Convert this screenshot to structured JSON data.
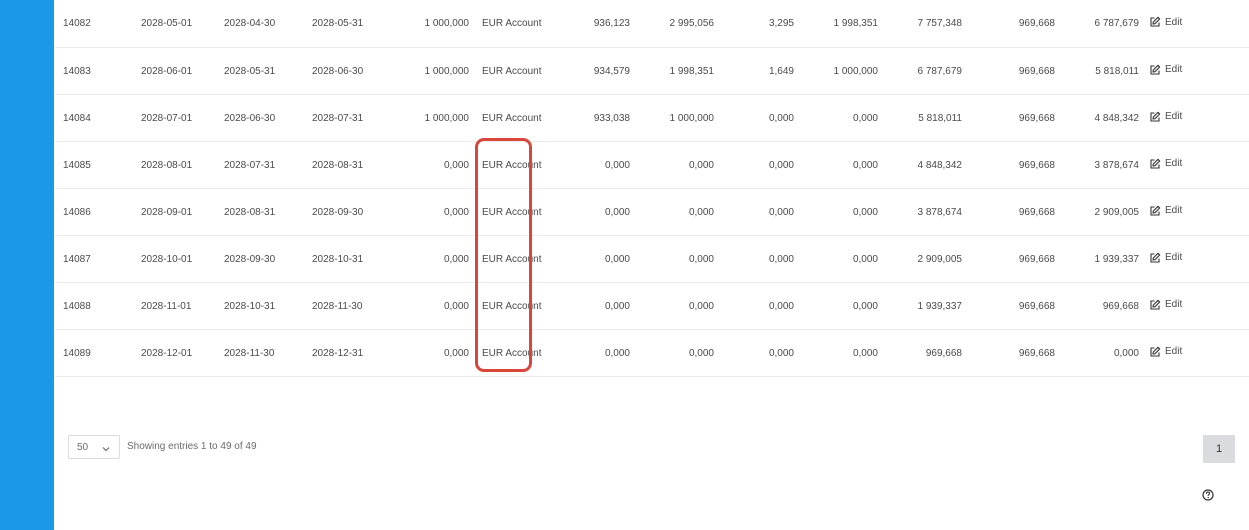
{
  "table": {
    "edit_label": "Edit",
    "rows": [
      {
        "id": "14082",
        "c1": "2028-05-01",
        "c2": "2028-04-30",
        "c3": "2028-05-31",
        "amount": "1 000,000",
        "account": "EUR Account",
        "v1": "936,123",
        "v2": "2 995,056",
        "v3": "3,295",
        "v4": "1 998,351",
        "v5": "7 757,348",
        "v6": "969,668",
        "v7": "6 787,679"
      },
      {
        "id": "14083",
        "c1": "2028-06-01",
        "c2": "2028-05-31",
        "c3": "2028-06-30",
        "amount": "1 000,000",
        "account": "EUR Account",
        "v1": "934,579",
        "v2": "1 998,351",
        "v3": "1,649",
        "v4": "1 000,000",
        "v5": "6 787,679",
        "v6": "969,668",
        "v7": "5 818,011"
      },
      {
        "id": "14084",
        "c1": "2028-07-01",
        "c2": "2028-06-30",
        "c3": "2028-07-31",
        "amount": "1 000,000",
        "account": "EUR Account",
        "v1": "933,038",
        "v2": "1 000,000",
        "v3": "0,000",
        "v4": "0,000",
        "v5": "5 818,011",
        "v6": "969,668",
        "v7": "4 848,342"
      },
      {
        "id": "14085",
        "c1": "2028-08-01",
        "c2": "2028-07-31",
        "c3": "2028-08-31",
        "amount": "0,000",
        "account": "EUR Account",
        "v1": "0,000",
        "v2": "0,000",
        "v3": "0,000",
        "v4": "0,000",
        "v5": "4 848,342",
        "v6": "969,668",
        "v7": "3 878,674"
      },
      {
        "id": "14086",
        "c1": "2028-09-01",
        "c2": "2028-08-31",
        "c3": "2028-09-30",
        "amount": "0,000",
        "account": "EUR Account",
        "v1": "0,000",
        "v2": "0,000",
        "v3": "0,000",
        "v4": "0,000",
        "v5": "3 878,674",
        "v6": "969,668",
        "v7": "2 909,005"
      },
      {
        "id": "14087",
        "c1": "2028-10-01",
        "c2": "2028-09-30",
        "c3": "2028-10-31",
        "amount": "0,000",
        "account": "EUR Account",
        "v1": "0,000",
        "v2": "0,000",
        "v3": "0,000",
        "v4": "0,000",
        "v5": "2 909,005",
        "v6": "969,668",
        "v7": "1 939,337"
      },
      {
        "id": "14088",
        "c1": "2028-11-01",
        "c2": "2028-10-31",
        "c3": "2028-11-30",
        "amount": "0,000",
        "account": "EUR Account",
        "v1": "0,000",
        "v2": "0,000",
        "v3": "0,000",
        "v4": "0,000",
        "v5": "1 939,337",
        "v6": "969,668",
        "v7": "969,668"
      },
      {
        "id": "14089",
        "c1": "2028-12-01",
        "c2": "2028-11-30",
        "c3": "2028-12-31",
        "amount": "0,000",
        "account": "EUR Account",
        "v1": "0,000",
        "v2": "0,000",
        "v3": "0,000",
        "v4": "0,000",
        "v5": "969,668",
        "v6": "969,668",
        "v7": "0,000"
      }
    ]
  },
  "footer": {
    "page_size": "50",
    "entries_info": "Showing entries 1 to 49 of 49",
    "current_page": "1"
  },
  "colors": {
    "sidebar": "#1b98e6",
    "highlight": "#d9473a",
    "page_button_bg": "#d9dbdf"
  },
  "icons": {
    "edit": "edit-icon",
    "chevron": "chevron-down-icon",
    "help": "help-icon"
  }
}
